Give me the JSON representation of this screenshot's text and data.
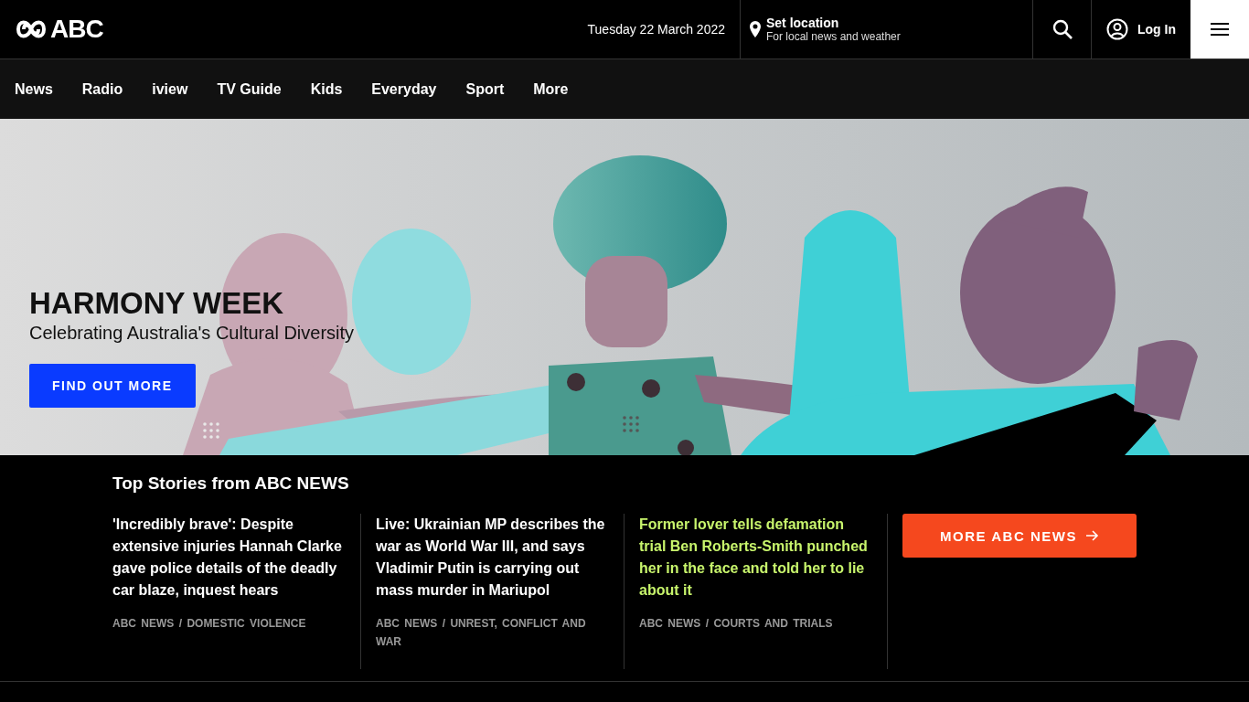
{
  "header": {
    "logo_text": "ABC",
    "date": "Tuesday 22 March 2022",
    "location": {
      "title": "Set location",
      "subtitle": "For local news and weather"
    },
    "login": "Log In"
  },
  "nav": [
    {
      "label": "News"
    },
    {
      "label": "Radio"
    },
    {
      "label": "iview"
    },
    {
      "label": "TV Guide"
    },
    {
      "label": "Kids"
    },
    {
      "label": "Everyday"
    },
    {
      "label": "Sport"
    },
    {
      "label": "More"
    }
  ],
  "hero": {
    "title": "HARMONY WEEK",
    "subtitle": "Celebrating Australia's Cultural Diversity",
    "button": "FIND OUT MORE"
  },
  "top_stories": {
    "heading": "Top Stories from ABC NEWS",
    "stories": [
      {
        "headline": "'Incredibly brave': Despite extensive injuries Hannah Clarke gave police details of the deadly car blaze, inquest hears",
        "source": "ABC NEWS",
        "separator": "/",
        "topic": "DOMESTIC VIOLENCE",
        "highlighted": false
      },
      {
        "headline": "Live: Ukrainian MP describes the war as World War III, and says Vladimir Putin is carrying out mass murder in Mariupol",
        "source": "ABC NEWS",
        "separator": "/",
        "topic": "UNREST, CONFLICT AND WAR",
        "highlighted": false
      },
      {
        "headline": "Former lover tells defamation trial Ben Roberts-Smith punched her in the face and told her to lie about it",
        "source": "ABC NEWS",
        "separator": "/",
        "topic": "COURTS AND TRIALS",
        "highlighted": true
      }
    ],
    "more_button": "MORE ABC NEWS"
  }
}
